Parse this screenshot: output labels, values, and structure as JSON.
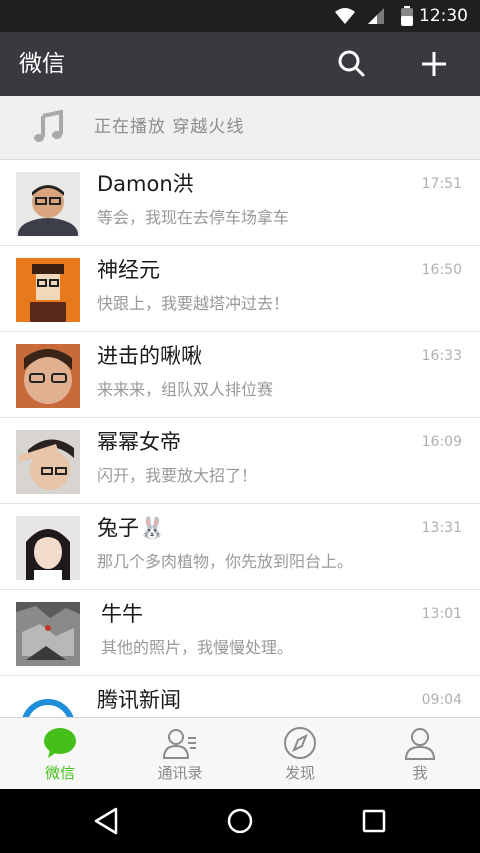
{
  "status_bar": {
    "time": "12:30"
  },
  "header": {
    "title": "微信",
    "search_icon": "search-icon",
    "add_icon": "plus-icon"
  },
  "now_playing": {
    "label": "正在播放  穿越火线",
    "icon": "music-note-icon"
  },
  "chats": [
    {
      "name": "Damon洪",
      "time": "17:51",
      "message": "等会，我现在去停车场拿车"
    },
    {
      "name": "神经元",
      "time": "16:50",
      "message": "快跟上，我要越塔冲过去！"
    },
    {
      "name": "进击的啾啾",
      "time": "16:33",
      "message": "来来来，组队双人排位赛"
    },
    {
      "name": "幂幂女帝",
      "time": "16:09",
      "message": "闪开，我要放大招了！"
    },
    {
      "name": "兔子🐰",
      "time": "13:31",
      "message": "那几个多肉植物，你先放到阳台上。"
    },
    {
      "name": "牛牛",
      "time": "13:01",
      "message": "其他的照片，我慢慢处理。"
    },
    {
      "name": "腾讯新闻",
      "time": "09:04",
      "message": ""
    }
  ],
  "tabs": [
    {
      "label": "微信",
      "icon": "chat-bubble-icon",
      "active": true
    },
    {
      "label": "通讯录",
      "icon": "contacts-icon",
      "active": false
    },
    {
      "label": "发现",
      "icon": "compass-icon",
      "active": false
    },
    {
      "label": "我",
      "icon": "person-icon",
      "active": false
    }
  ],
  "colors": {
    "header_bg": "#393a3f",
    "accent_green": "#45c01a",
    "status_bar_bg": "#1f1f1f"
  }
}
